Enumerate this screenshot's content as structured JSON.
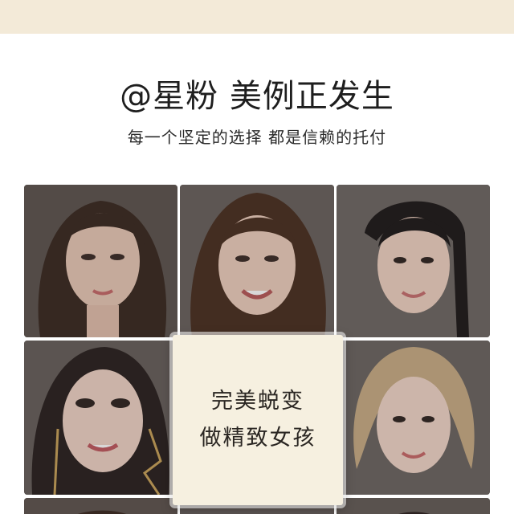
{
  "header": {
    "title": "@星粉 美例正发生",
    "subtitle": "每一个坚定的选择 都是信赖的托付"
  },
  "gallery": {
    "photos": [
      {
        "subject": "woman-portrait-long-brown-hair"
      },
      {
        "subject": "woman-portrait-smiling"
      },
      {
        "subject": "woman-portrait-hair-tied-back"
      },
      {
        "subject": "woman-portrait-earrings"
      },
      {
        "subject": "woman-portrait-short-blonde-bob"
      }
    ],
    "caption": {
      "line1": "完美蜕变",
      "line2": "做精致女孩"
    }
  },
  "colors": {
    "top_band": "#f3ead8",
    "caption_card": "#f6f0e0",
    "heading_text": "#1e1e1e"
  }
}
